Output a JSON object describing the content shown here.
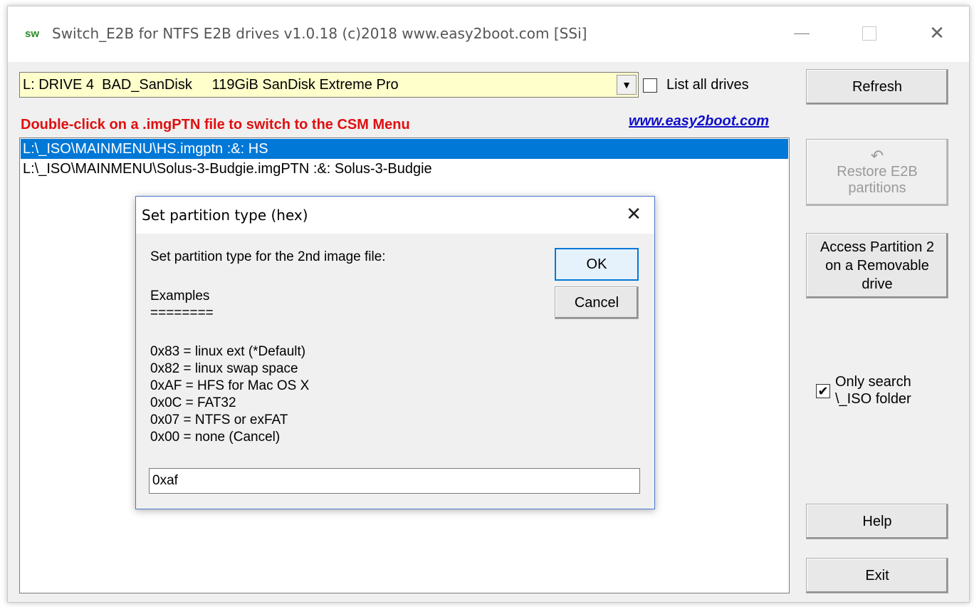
{
  "window": {
    "app_icon": "sw",
    "title": "Switch_E2B  for NTFS E2B drives   v1.0.18  (c)2018 www.easy2boot.com [SSi]",
    "min_icon": "minimize-icon",
    "max_icon": "maximize-icon",
    "close_icon": "close-icon"
  },
  "drive": {
    "selected": "L: DRIVE 4  BAD_SanDisk     119GiB SanDisk Extreme Pro",
    "arrow": "▼"
  },
  "list_all": {
    "label": "List all drives",
    "checked": false
  },
  "instructions": "Double-click on a .imgPTN file to switch to the CSM Menu",
  "site_link": "www.easy2boot.com",
  "files": [
    {
      "path": "L:\\_ISO\\MAINMENU\\HS.imgptn :&: HS",
      "selected": true
    },
    {
      "path": "L:\\_ISO\\MAINMENU\\Solus-3-Budgie.imgPTN :&: Solus-3-Budgie",
      "selected": false
    }
  ],
  "buttons": {
    "refresh": "Refresh",
    "restore_icon": "↶",
    "restore_line1": "Restore E2B",
    "restore_line2": "partitions",
    "access": "Access Partition 2 on a Removable drive",
    "help": "Help",
    "exit": "Exit"
  },
  "only_search": {
    "line1": "Only search",
    "line2": "\\_ISO folder",
    "checked": true,
    "mark": "✔"
  },
  "dialog": {
    "title": "Set partition type (hex)",
    "close": "✕",
    "prompt": "Set partition type for the 2nd image file:",
    "examples": "Examples",
    "rule": "========",
    "lines": [
      "0x83 = linux ext (*Default)",
      "0x82 = linux swap space",
      "0xAF = HFS for Mac OS X",
      "0x0C = FAT32",
      "0x07 = NTFS or exFAT",
      "0x00 = none (Cancel)"
    ],
    "ok": "OK",
    "cancel": "Cancel",
    "input_value": "0xaf"
  }
}
